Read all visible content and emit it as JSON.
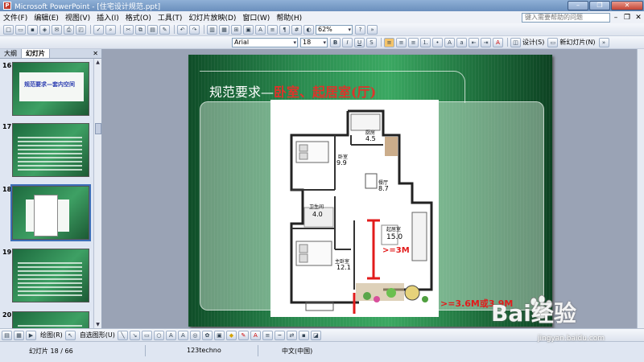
{
  "window": {
    "title": "Microsoft PowerPoint - [住宅设计规范.ppt]",
    "app_icon": "powerpoint-icon"
  },
  "menu": {
    "items": [
      "文件(F)",
      "编辑(E)",
      "视图(V)",
      "插入(I)",
      "格式(O)",
      "工具(T)",
      "幻灯片放映(D)",
      "窗口(W)",
      "帮助(H)"
    ],
    "ask_placeholder": "键入需要帮助的问题"
  },
  "toolbar": {
    "zoom": "62%",
    "font_name": "Arial",
    "font_size": "18",
    "design_label": "设计(S)",
    "new_slide_label": "新幻灯片(N)"
  },
  "pane": {
    "tabs": [
      "大纲",
      "幻灯片"
    ],
    "slides": [
      {
        "number": "16",
        "title": "规范要求—套内空间"
      },
      {
        "number": "17",
        "title": ""
      },
      {
        "number": "18",
        "title": ""
      },
      {
        "number": "19",
        "title": ""
      },
      {
        "number": "20",
        "title": ""
      }
    ]
  },
  "slide": {
    "title_main": "规范要求—",
    "title_sub": "卧室、起居室(厅)",
    "annotation_width": ">=3M",
    "annotation_depth": ">=3.6M或3.9M",
    "plan": {
      "kitchen_label": "厨房",
      "kitchen_area": "4.5",
      "bedroom1_label": "卧室",
      "bedroom1_area": "9.9",
      "dining_label": "餐厅",
      "dining_area": "8.7",
      "bath_label": "卫生间",
      "bath_area": "4.0",
      "living_label": "起居室",
      "living_area": "15.0",
      "master_label": "主卧室",
      "master_area": "12.1"
    }
  },
  "drawbar": {
    "draw_label": "绘图(R)",
    "autoshape_label": "自选图形(U)"
  },
  "status": {
    "slide_counter": "幻灯片 18 / 66",
    "design_name": "123techno",
    "language": "中文(中国)"
  },
  "watermark": {
    "brand": "Bai经验",
    "url": "jingyan.baidu.com"
  }
}
